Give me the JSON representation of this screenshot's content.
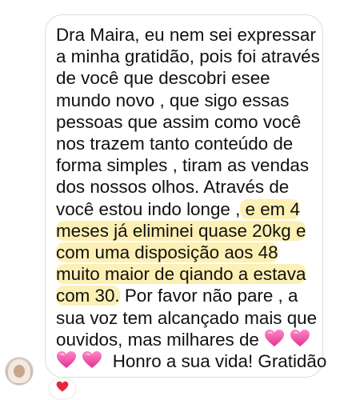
{
  "message": {
    "lines": [
      "Dra Maira, eu nem sei expressar",
      "a minha gratidão, pois foi através",
      "de você que descobri esee",
      "mundo novo , que sigo essas",
      "pessoas que assim como você",
      "nos trazem tanto conteúdo de",
      "forma simples , tiram as vendas",
      "dos nossos olhos. Através de"
    ],
    "line9_plain": "você estou indo longe ,",
    "line9_highlight": " e em 4",
    "line10_highlight": "meses já eliminei quase 20kg e",
    "line11_highlight": "com uma disposição aos 48",
    "line12_highlight": "muito maior de qiando a estava",
    "line13_highlight": "com 30.",
    "line13_plain": " Por favor não pare , a",
    "line14": "sua voz tem alcançado mais que",
    "line15": "ouvidos, mas milhares de ",
    "line16_text": "Honro a sua vida! Gratidão"
  },
  "icons": {
    "heart_emoji": "pink-heart-icon",
    "reaction": "red-heart-icon",
    "avatar": "user-avatar"
  },
  "colors": {
    "highlight": "#fdf0b4",
    "bubble_border": "#dcdcdc",
    "heart_pink": "#f24aa0",
    "reaction_red": "#e8273b"
  }
}
